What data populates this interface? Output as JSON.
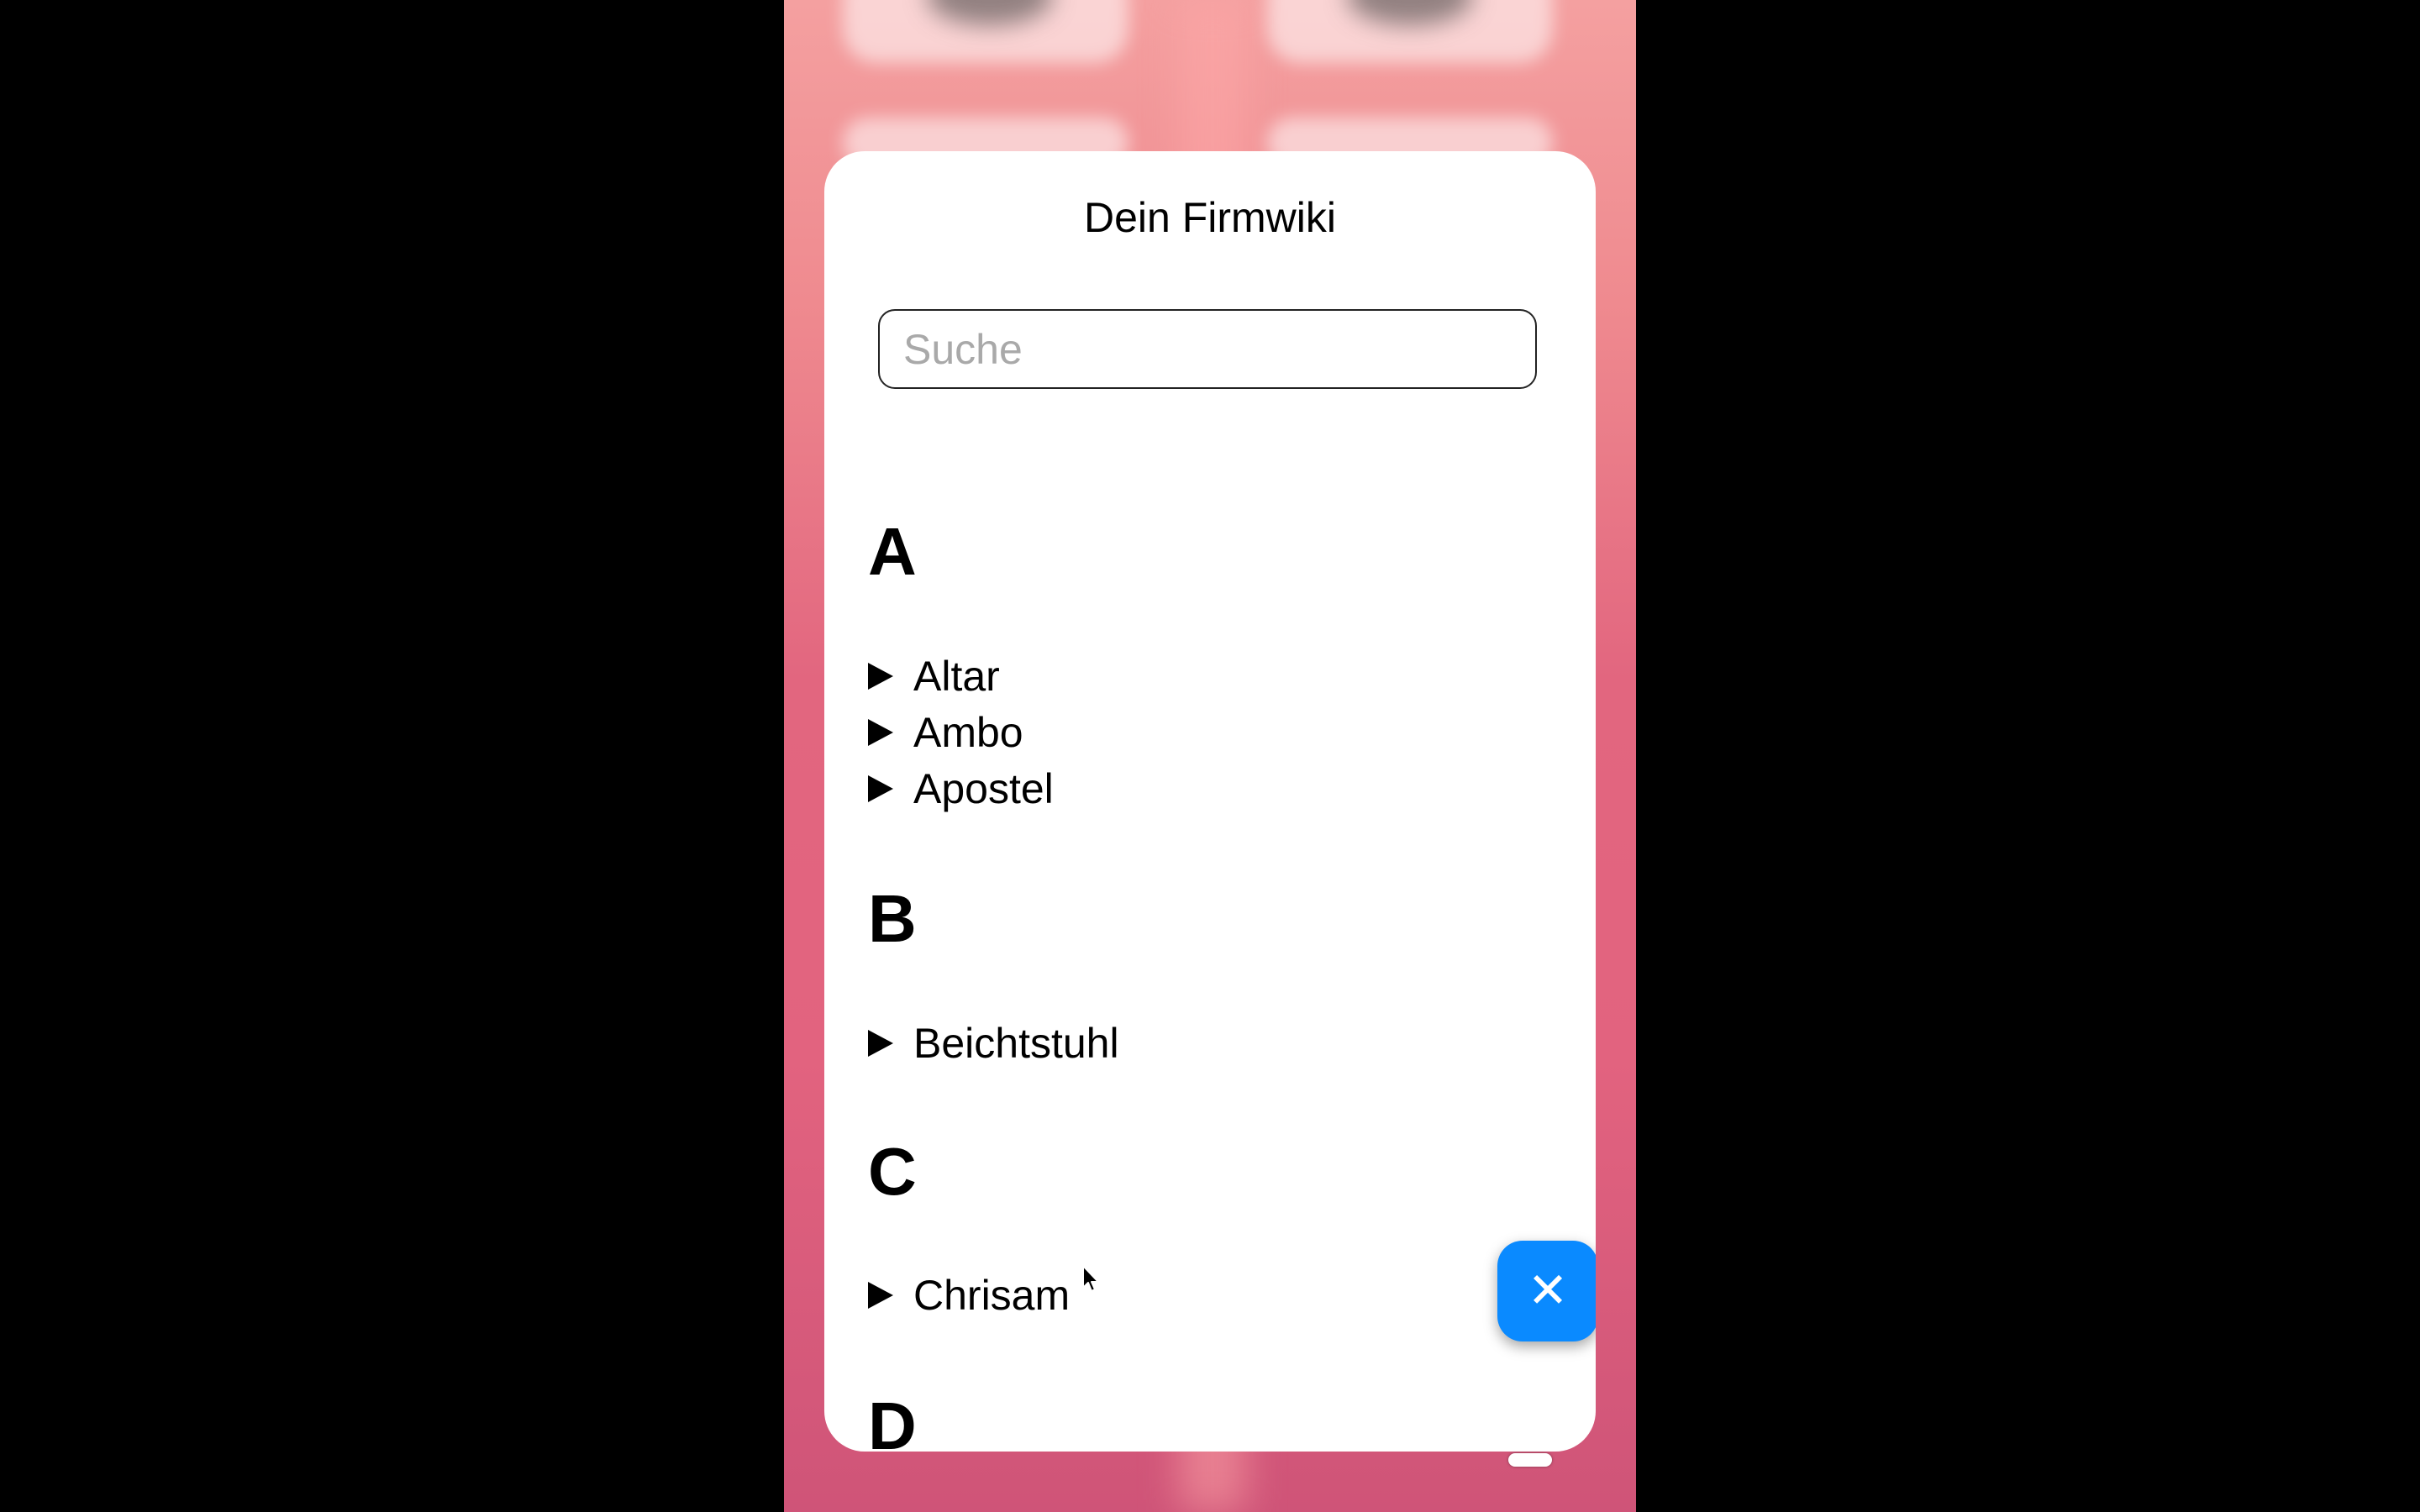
{
  "wiki": {
    "title": "Dein Firmwiki",
    "search": {
      "placeholder": "Suche",
      "value": ""
    },
    "sections": [
      {
        "letter": "A",
        "entries": [
          "Altar",
          "Ambo",
          "Apostel"
        ]
      },
      {
        "letter": "B",
        "entries": [
          "Beichtstuhl"
        ]
      },
      {
        "letter": "C",
        "entries": [
          "Chrisam"
        ]
      },
      {
        "letter": "D",
        "entries": []
      }
    ],
    "close_button": {
      "icon": "close-icon",
      "color": "#0a8aff"
    }
  }
}
